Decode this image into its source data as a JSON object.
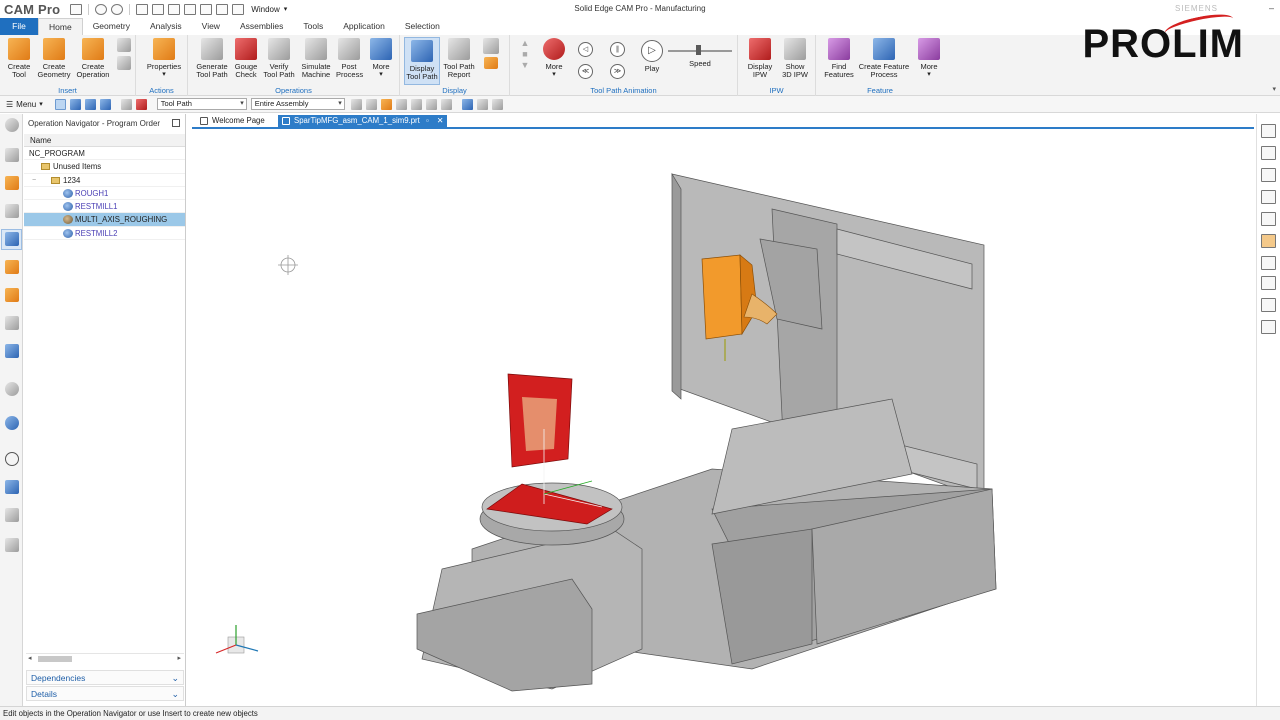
{
  "titlebar": {
    "app_name": "CAM Pro",
    "window_menu": "Window",
    "title": "Solid Edge CAM Pro - Manufacturing",
    "brand": "SIEMENS"
  },
  "tabs": [
    {
      "label": "File"
    },
    {
      "label": "Home"
    },
    {
      "label": "Geometry"
    },
    {
      "label": "Analysis"
    },
    {
      "label": "View"
    },
    {
      "label": "Assemblies"
    },
    {
      "label": "Tools"
    },
    {
      "label": "Application"
    },
    {
      "label": "Selection"
    }
  ],
  "ribbon": {
    "insert": {
      "label": "Insert",
      "create_tool": "Create\nTool",
      "create_geometry": "Create\nGeometry",
      "create_operation": "Create\nOperation"
    },
    "actions": {
      "label": "Actions",
      "properties": "Properties"
    },
    "operations": {
      "label": "Operations",
      "generate_tool_path": "Generate\nTool Path",
      "gouge_check": "Gouge\nCheck",
      "verify_tool_path": "Verify\nTool Path",
      "simulate_machine": "Simulate\nMachine",
      "post_process": "Post\nProcess",
      "more": "More"
    },
    "display": {
      "label": "Display",
      "display_tool_path": "Display\nTool Path",
      "tool_path_report": "Tool Path\nReport"
    },
    "animation": {
      "label": "Tool Path Animation",
      "more": "More",
      "play": "Play",
      "speed": "Speed"
    },
    "ipw": {
      "label": "IPW",
      "display_ipw": "Display\nIPW",
      "show_3d_ipw": "Show\n3D IPW"
    },
    "feature": {
      "label": "Feature",
      "find_features": "Find\nFeatures",
      "create_feature_process": "Create Feature\nProcess",
      "more": "More"
    }
  },
  "brand_logo": {
    "text": "PROLIM"
  },
  "toolbar2": {
    "menu": "Menu",
    "filter_select": "Tool Path",
    "scope_select": "Entire Assembly"
  },
  "navigator": {
    "title": "Operation Navigator - Program Order",
    "column_header": "Name",
    "rows": [
      {
        "label": "NC_PROGRAM"
      },
      {
        "label": "Unused Items"
      },
      {
        "label": "1234"
      },
      {
        "label": "ROUGH1"
      },
      {
        "label": "RESTMILL1"
      },
      {
        "label": "MULTI_AXIS_ROUGHING"
      },
      {
        "label": "RESTMILL2"
      }
    ],
    "dependencies": "Dependencies",
    "details": "Details"
  },
  "document_tabs": [
    {
      "label": "Welcome Page"
    },
    {
      "label": "SparTipMFG_asm_CAM_1_sim9.prt"
    }
  ],
  "status": {
    "message": "Edit objects in the Operation Navigator or use Insert to create new objects"
  },
  "colors": {
    "accent": "#1f6fbf",
    "selection": "#9bc8e8",
    "workpiece": "#d21f1f",
    "spindle": "#f29a2c"
  }
}
